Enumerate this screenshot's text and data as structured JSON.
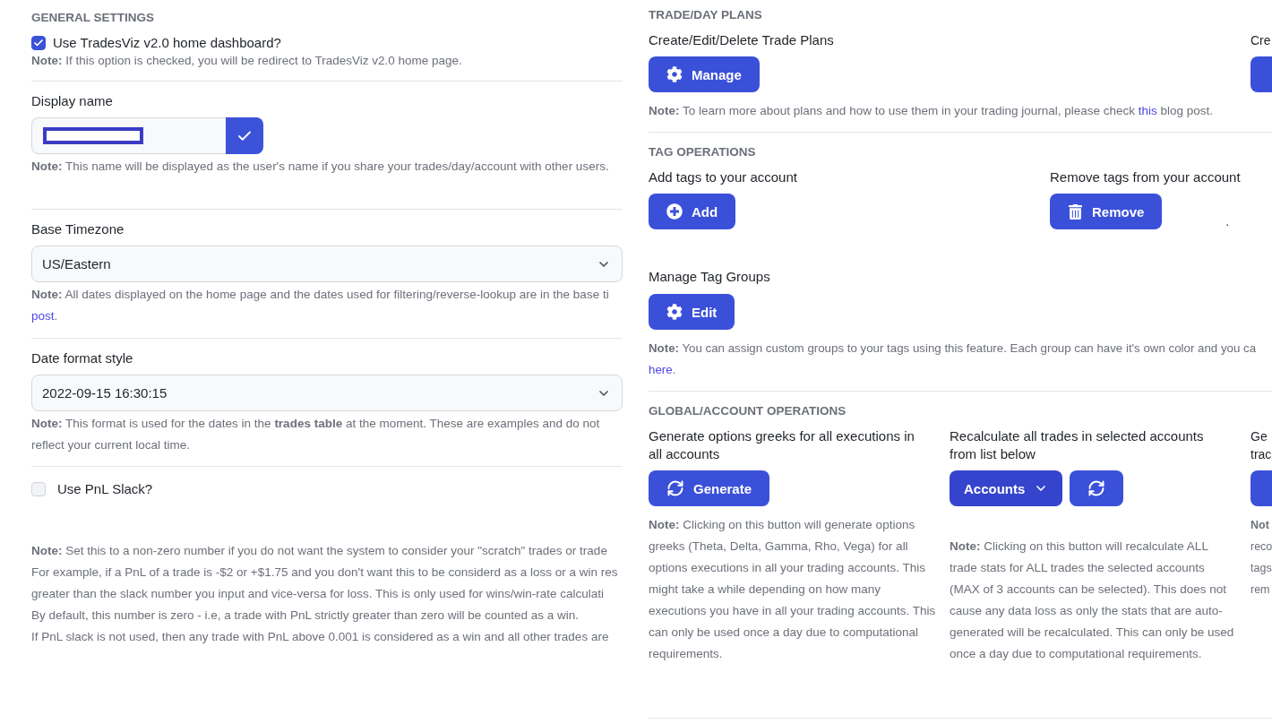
{
  "general_settings": {
    "heading": "GENERAL SETTINGS",
    "dashboard_option": {
      "label": "Use TradesViz v2.0 home dashboard?",
      "checked": true,
      "note": "**Note:** If this option is checked, you will be redirect to TradesViz v2.0 home page."
    },
    "display_name": {
      "label": "Display name",
      "redacted": true,
      "note": "**Note:** This name will be displayed as the user's name if you share your trades/day/account with other users."
    },
    "base_timezone": {
      "label": "Base Timezone",
      "value": "US/Eastern",
      "note_lines": [
        [
          {
            "kind": "text",
            "text": "**Note:** All dates displayed on the home page and the dates used for filtering/reverse-lookup are in the base ti"
          }
        ],
        [
          {
            "kind": "link",
            "text": "post"
          },
          {
            "kind": "text",
            "text": "."
          }
        ]
      ]
    },
    "date_format": {
      "label": "Date format style",
      "value": "2022-09-15 16:30:15",
      "note": "**Note:** This format is used for the dates in the **trades table** at the moment. These are examples and do not reflect your current local time."
    },
    "pnl_slack": {
      "label": "Use PnL Slack?",
      "checked": false,
      "note_lines": [
        [
          {
            "kind": "text",
            "text": "**Note:** Set this to a non-zero number if you do not want the system to consider your \"scratch\" trades or trade"
          }
        ],
        [
          {
            "kind": "text",
            "text": "For example, if a PnL of a trade is -$2 or +$1.75 and you don't want this to be considerd as a loss or a win res"
          }
        ],
        [
          {
            "kind": "text",
            "text": "greater than the slack number you input and vice-versa for loss. This is only used for wins/win-rate calculati"
          }
        ],
        [
          {
            "kind": "text",
            "text": "By default, this number is zero - i.e, a trade with PnL strictly greater than zero will be counted as a win."
          }
        ],
        [
          {
            "kind": "text",
            "text": "If PnL slack is not used, then any trade with PnL above 0.001 is considered as a win and all other trades are"
          }
        ]
      ]
    }
  },
  "trade_day_plans": {
    "heading": "TRADE/DAY PLANS",
    "items": [
      {
        "kind": "full",
        "title": "Create/Edit/Delete Trade Plans",
        "button": "Manage"
      },
      {
        "kind": "cropped",
        "title": "Cre"
      }
    ],
    "note_lines": [
      [
        {
          "kind": "text",
          "text": "**Note:** To learn more about plans and how to use them in your trading journal, please check "
        },
        {
          "kind": "link",
          "text": "this"
        },
        {
          "kind": "text",
          "text": " blog post."
        }
      ]
    ]
  },
  "tag_operations": {
    "heading": "TAG OPERATIONS",
    "actions": [
      {
        "title": "Add tags to your account",
        "button": "Add"
      },
      {
        "title": "Remove tags from your account",
        "button": "Remove",
        "trailing_mark": "."
      }
    ],
    "groups": {
      "title": "Manage Tag Groups",
      "button": "Edit",
      "note_lines": [
        [
          {
            "kind": "text",
            "text": "**Note:** You can assign custom groups to your tags using this feature. Each group can have it's own color and you ca"
          }
        ],
        [
          {
            "kind": "link",
            "text": "here"
          },
          {
            "kind": "text",
            "text": "."
          }
        ]
      ]
    }
  },
  "global_operations": {
    "heading": "GLOBAL/ACCOUNT OPERATIONS",
    "columns": [
      {
        "kind": "full",
        "title": "Generate options greeks for all executions in all accounts",
        "buttons": [
          {
            "kind": "labeled",
            "label": "Generate"
          }
        ],
        "note": "**Note:** Clicking on this button will generate options greeks (Theta, Delta, Gamma, Rho, Vega) for all options executions in all your trading accounts. This might take a while depending on how many executions you have in all your trading accounts. This can only be used once a day due to computational requirements."
      },
      {
        "kind": "full",
        "title": "Recalculate all trades in selected accounts from list below",
        "buttons": [
          {
            "kind": "dropdown",
            "label": "Accounts"
          },
          {
            "kind": "icon"
          }
        ],
        "note": "**Note:** Clicking on this button will recalculate ALL trade stats for ALL trades the selected accounts (MAX of 3 accounts can be selected). This does not cause any data loss as only the stats that are auto-generated will be recalculated. This can only be used once a day due to computational requirements."
      },
      {
        "kind": "cropped",
        "title": "Ge trac",
        "buttons": [
          {
            "kind": "cropped"
          }
        ],
        "note": "**Not** reco tags rem"
      }
    ]
  }
}
